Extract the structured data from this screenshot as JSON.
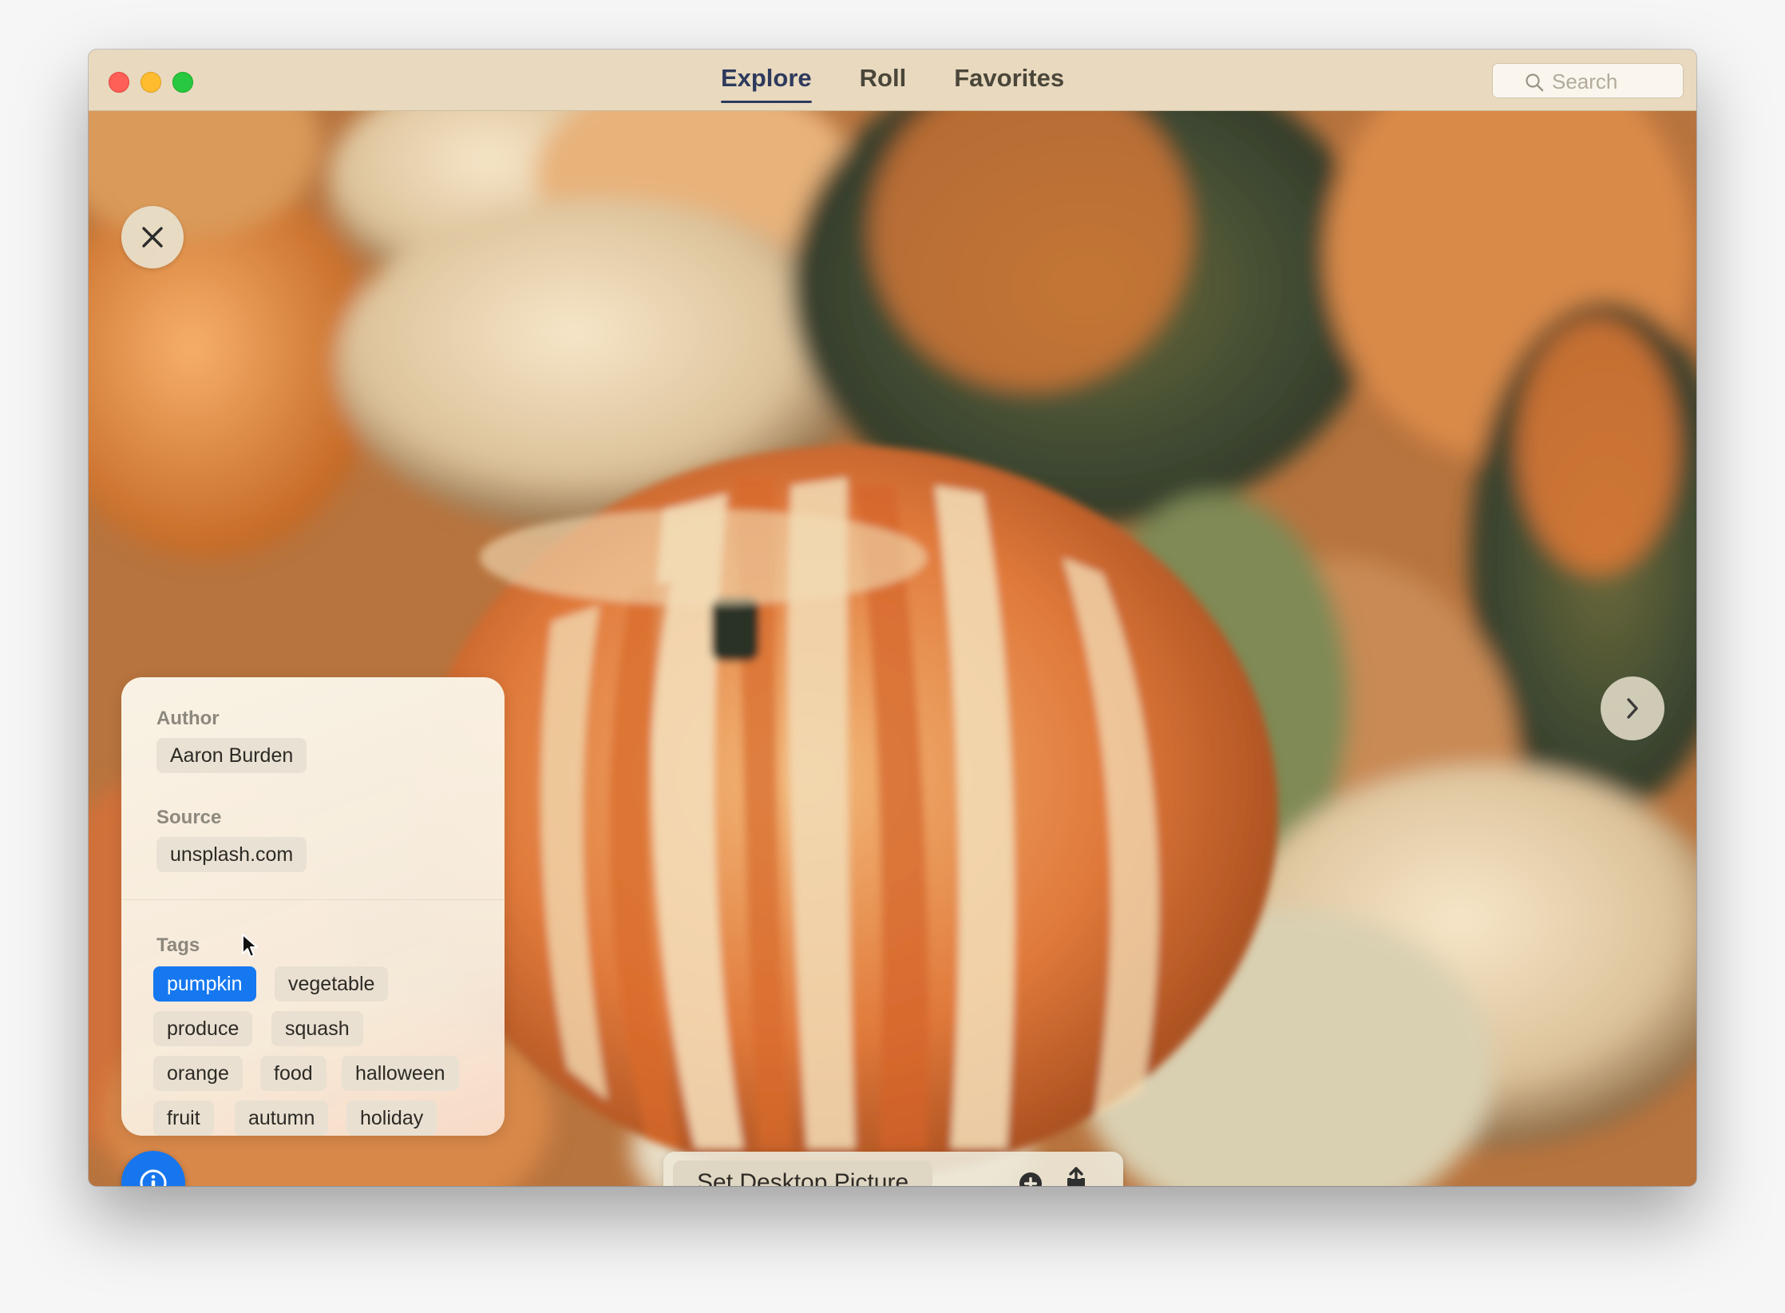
{
  "titlebar": {
    "tabs": [
      {
        "label": "Explore",
        "active": true
      },
      {
        "label": "Roll",
        "active": false
      },
      {
        "label": "Favorites",
        "active": false
      }
    ],
    "search": {
      "placeholder": "Search",
      "value": ""
    }
  },
  "info": {
    "author_label": "Author",
    "author": "Aaron Burden",
    "source_label": "Source",
    "source": "unsplash.com",
    "tags_label": "Tags",
    "tags": [
      "pumpkin",
      "vegetable",
      "produce",
      "squash",
      "orange",
      "food",
      "halloween",
      "fruit",
      "autumn",
      "holiday"
    ],
    "selected_tag": "pumpkin"
  },
  "actions": {
    "set_desktop_label": "Set Desktop Picture"
  },
  "icons": [
    "close-icon",
    "chevron-right-icon",
    "info-icon",
    "add-icon",
    "share-icon",
    "search-icon"
  ],
  "colors": {
    "titlebar": "#e8d9bf",
    "accent_blue": "#1578f0",
    "tab_active": "#2e3a5c"
  }
}
